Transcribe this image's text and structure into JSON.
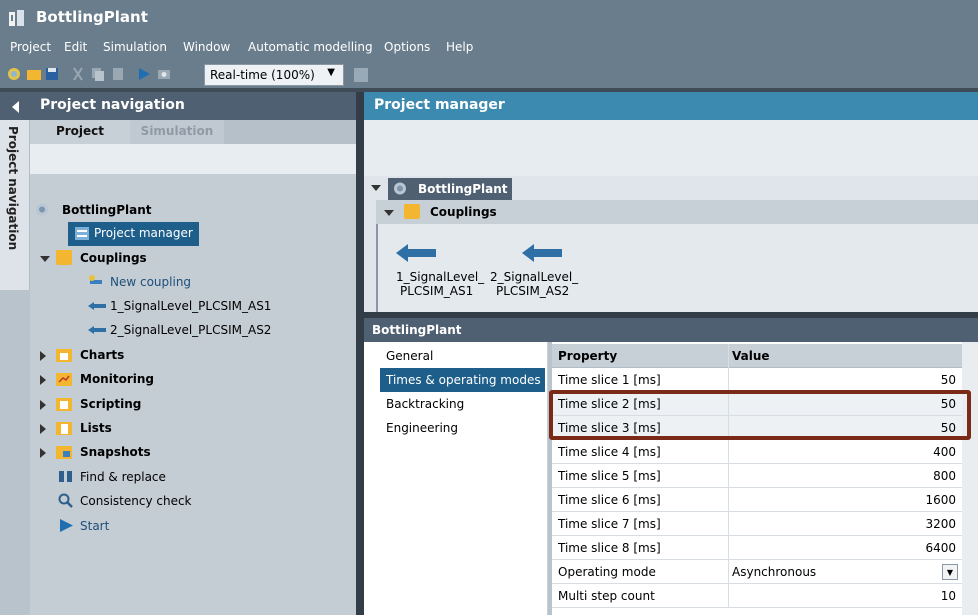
{
  "app": {
    "title": "BottlingPlant"
  },
  "menu": [
    "Project",
    "Edit",
    "Simulation",
    "Window",
    "Automatic modelling",
    "Options",
    "Help"
  ],
  "toolbar": {
    "speed_value": "Real-time (100%)",
    "icons": [
      "new-project-icon",
      "open-folder-icon",
      "save-icon",
      "cut-icon",
      "copy-icon",
      "paste-icon",
      "start-simulation-icon",
      "snapshot-icon",
      "stop-icon"
    ]
  },
  "nav": {
    "header": "Project navigation",
    "vertical_tab": "Project navigation",
    "tabs": [
      "Project",
      "Simulation"
    ],
    "tree": {
      "root": "BottlingPlant",
      "project_manager": "Project manager",
      "couplings": "Couplings",
      "new_coupling": "New coupling",
      "coupling_1": "1_SignalLevel_PLCSIM_AS1",
      "coupling_2": "2_SignalLevel_PLCSIM_AS2",
      "charts": "Charts",
      "monitoring": "Monitoring",
      "scripting": "Scripting",
      "lists": "Lists",
      "snapshots": "Snapshots",
      "find_replace": "Find & replace",
      "consistency": "Consistency check",
      "start": "Start"
    }
  },
  "project_manager": {
    "header": "Project manager",
    "root": "BottlingPlant",
    "couplings": "Couplings",
    "items": [
      {
        "line1": "1_SignalLevel_",
        "line2": "PLCSIM_AS1"
      },
      {
        "line1": "2_SignalLevel_",
        "line2": "PLCSIM_AS2"
      }
    ]
  },
  "properties": {
    "header": "BottlingPlant",
    "categories": [
      "General",
      "Times & operating modes",
      "Backtracking",
      "Engineering"
    ],
    "selected_category": "Times & operating modes",
    "columns": {
      "property": "Property",
      "value": "Value"
    },
    "rows": [
      {
        "property": "Time slice 1 [ms]",
        "value": "50"
      },
      {
        "property": "Time slice 2 [ms]",
        "value": "50"
      },
      {
        "property": "Time slice 3 [ms]",
        "value": "50"
      },
      {
        "property": "Time slice 4 [ms]",
        "value": "400"
      },
      {
        "property": "Time slice 5 [ms]",
        "value": "800"
      },
      {
        "property": "Time slice 6 [ms]",
        "value": "1600"
      },
      {
        "property": "Time slice 7 [ms]",
        "value": "3200"
      },
      {
        "property": "Time slice 8 [ms]",
        "value": "6400"
      },
      {
        "property": "Operating mode",
        "value": "Asynchronous"
      },
      {
        "property": "Multi step count",
        "value": "10"
      }
    ]
  },
  "colors": {
    "accent": "#1d5e8a",
    "highlight": "#7a2a16",
    "header": "#3d8ab0"
  }
}
